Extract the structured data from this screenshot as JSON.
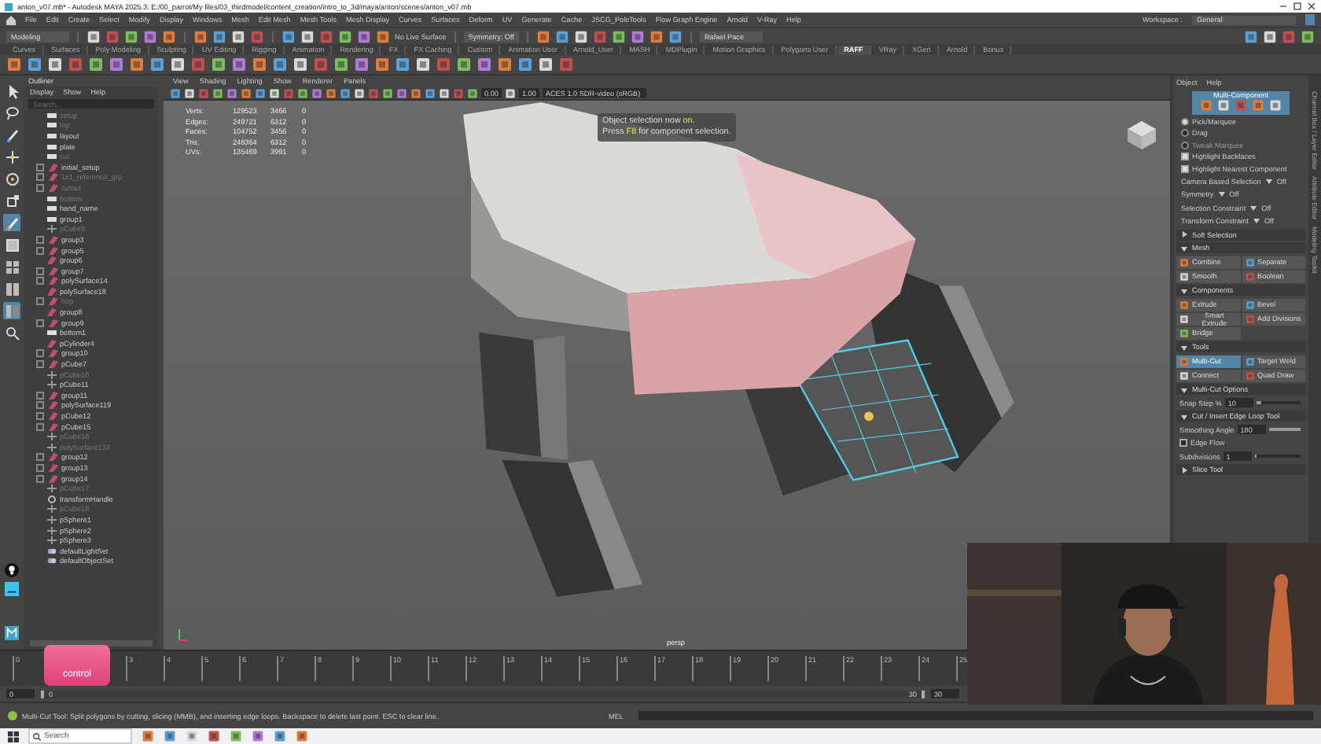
{
  "window": {
    "title": "anton_v07.mb* - Autodesk MAYA 2025.3: E:/00_parrot/My files/03_thirdmodel/content_creation/intro_to_3d/maya/anton/scenes/anton_v07.mb"
  },
  "menu": [
    "File",
    "Edit",
    "Create",
    "Select",
    "Modify",
    "Display",
    "Windows",
    "Mesh",
    "Edit Mesh",
    "Mesh Tools",
    "Mesh Display",
    "Curves",
    "Surfaces",
    "Deform",
    "UV",
    "Generate",
    "Cache",
    "JSCG_PoleTools",
    "Flow Graph Engine",
    "Arnold",
    "V-Ray",
    "Help"
  ],
  "workspace": {
    "label": "Workspace :",
    "value": "General"
  },
  "status_line": {
    "mode": "Modeling",
    "live_surface": "No Live Surface",
    "symmetry": "Symmetry: Off",
    "user": "Rafael Pace"
  },
  "shelf_tabs": [
    {
      "label": "Curves",
      "selected": false
    },
    {
      "label": "Surfaces",
      "selected": false
    },
    {
      "label": "Poly Modeling",
      "selected": false
    },
    {
      "label": "Sculpting",
      "selected": false
    },
    {
      "label": "UV Editing",
      "selected": false
    },
    {
      "label": "Rigging",
      "selected": false
    },
    {
      "label": "Animation",
      "selected": false
    },
    {
      "label": "Rendering",
      "selected": false
    },
    {
      "label": "FX",
      "selected": false
    },
    {
      "label": "FX Caching",
      "selected": false
    },
    {
      "label": "Custom",
      "selected": false
    },
    {
      "label": "Animation User",
      "selected": false
    },
    {
      "label": "Arnold_User",
      "selected": false
    },
    {
      "label": "MASH",
      "selected": false
    },
    {
      "label": "MDPlugin",
      "selected": false
    },
    {
      "label": "Motion Graphics",
      "selected": false
    },
    {
      "label": "Polygons User",
      "selected": false
    },
    {
      "label": "RAFF",
      "selected": true
    },
    {
      "label": "VRay",
      "selected": false
    },
    {
      "label": "XGen",
      "selected": false
    },
    {
      "label": "Arnold",
      "selected": false
    },
    {
      "label": "Bonus",
      "selected": false
    }
  ],
  "toolbox": [
    {
      "kind": "select",
      "selected": false
    },
    {
      "kind": "lasso",
      "selected": false
    },
    {
      "kind": "paint",
      "selected": false
    },
    {
      "kind": "move",
      "selected": false
    },
    {
      "kind": "rotate",
      "selected": false
    },
    {
      "kind": "scale",
      "selected": false
    },
    {
      "kind": "brush",
      "selected": true
    },
    {
      "kind": "single",
      "selected": false
    },
    {
      "kind": "four",
      "selected": false
    },
    {
      "kind": "two",
      "selected": false
    },
    {
      "kind": "outliner",
      "selected": true
    },
    {
      "kind": "search",
      "selected": false
    }
  ],
  "outliner": {
    "title": "Outliner",
    "menu": [
      "Display",
      "Show",
      "Help"
    ],
    "search": {
      "placeholder": "Search..."
    },
    "items": [
      {
        "label": "setup",
        "kind": "box",
        "dim": true,
        "expander": false
      },
      {
        "label": "top",
        "kind": "box",
        "dim": true,
        "expander": false
      },
      {
        "label": "layout",
        "kind": "box",
        "dim": false,
        "expander": false
      },
      {
        "label": "plate",
        "kind": "box",
        "dim": false,
        "expander": false
      },
      {
        "label": "cut",
        "kind": "box",
        "dim": true,
        "expander": false
      },
      {
        "label": "initial_setup",
        "kind": "mesh",
        "dim": false,
        "expander": true
      },
      {
        "label": "1x1_reference_grp",
        "kind": "mesh",
        "dim": true,
        "expander": true
      },
      {
        "label": "cutout",
        "kind": "mesh",
        "dim": true,
        "expander": true
      },
      {
        "label": "bottom",
        "kind": "box",
        "dim": true,
        "expander": false
      },
      {
        "label": "hand_name",
        "kind": "box",
        "dim": false,
        "expander": false
      },
      {
        "label": "group1",
        "kind": "box",
        "dim": false,
        "expander": false
      },
      {
        "label": "pCube9",
        "kind": "locator",
        "dim": true,
        "expander": false
      },
      {
        "label": "group3",
        "kind": "mesh",
        "dim": false,
        "expander": true
      },
      {
        "label": "group5",
        "kind": "mesh",
        "dim": false,
        "expander": true
      },
      {
        "label": "group6",
        "kind": "mesh",
        "dim": false,
        "expander": false
      },
      {
        "label": "group7",
        "kind": "mesh",
        "dim": false,
        "expander": true
      },
      {
        "label": "polySurface14",
        "kind": "mesh",
        "dim": false,
        "expander": true
      },
      {
        "label": "polySurface18",
        "kind": "mesh",
        "dim": false,
        "expander": false
      },
      {
        "label": "hop",
        "kind": "mesh",
        "dim": true,
        "expander": true
      },
      {
        "label": "group8",
        "kind": "mesh",
        "dim": false,
        "expander": false
      },
      {
        "label": "group9",
        "kind": "mesh",
        "dim": false,
        "expander": true
      },
      {
        "label": "bottom1",
        "kind": "box",
        "dim": false,
        "expander": false
      },
      {
        "label": "pCylinder4",
        "kind": "mesh",
        "dim": false,
        "expander": false
      },
      {
        "label": "group10",
        "kind": "mesh",
        "dim": false,
        "expander": true
      },
      {
        "label": "pCube7",
        "kind": "mesh",
        "dim": false,
        "expander": true
      },
      {
        "label": "pCube10",
        "kind": "locator",
        "dim": true,
        "expander": false
      },
      {
        "label": "pCube11",
        "kind": "locator",
        "dim": false,
        "expander": false
      },
      {
        "label": "group11",
        "kind": "mesh",
        "dim": false,
        "expander": true
      },
      {
        "label": "polySurface119",
        "kind": "mesh",
        "dim": false,
        "expander": true
      },
      {
        "label": "pCube12",
        "kind": "mesh",
        "dim": false,
        "expander": true
      },
      {
        "label": "pCube15",
        "kind": "mesh",
        "dim": false,
        "expander": true
      },
      {
        "label": "pCube16",
        "kind": "locator",
        "dim": true,
        "expander": false
      },
      {
        "label": "polySurface133",
        "kind": "locator",
        "dim": true,
        "expander": false
      },
      {
        "label": "group12",
        "kind": "mesh",
        "dim": false,
        "expander": true
      },
      {
        "label": "group13",
        "kind": "mesh",
        "dim": false,
        "expander": true
      },
      {
        "label": "group14",
        "kind": "mesh",
        "dim": false,
        "expander": true
      },
      {
        "label": "pCube17",
        "kind": "locator",
        "dim": true,
        "expander": false
      },
      {
        "label": "transformHandle",
        "kind": "gear",
        "dim": false,
        "expander": false
      },
      {
        "label": "pCube18",
        "kind": "locator",
        "dim": true,
        "expander": false
      },
      {
        "label": "pSphere1",
        "kind": "locator",
        "dim": false,
        "expander": false
      },
      {
        "label": "pSphere2",
        "kind": "locator",
        "dim": false,
        "expander": false
      },
      {
        "label": "pSphere3",
        "kind": "locator",
        "dim": false,
        "expander": false
      },
      {
        "label": "defaultLightSet",
        "kind": "set",
        "dim": false,
        "expander": false
      },
      {
        "label": "defaultObjectSet",
        "kind": "set",
        "dim": false,
        "expander": false
      }
    ]
  },
  "viewport": {
    "menu": [
      "View",
      "Shading",
      "Lighting",
      "Show",
      "Renderer",
      "Panels"
    ],
    "exposure": "0.00",
    "gamma": "1.00",
    "color_space": "ACES 1.0 SDR-video (sRGB)",
    "hud": [
      {
        "label": "Verts:",
        "values": [
          "129523",
          "3466",
          "0"
        ]
      },
      {
        "label": "Edges:",
        "values": [
          "249721",
          "6312",
          "0"
        ]
      },
      {
        "label": "Faces:",
        "values": [
          "104752",
          "3456",
          "0"
        ]
      },
      {
        "label": "Tris:",
        "values": [
          "248364",
          "6312",
          "0"
        ]
      },
      {
        "label": "UVs:",
        "values": [
          "135469",
          "3991",
          "0"
        ]
      }
    ],
    "tooltip": [
      "Object selection now **on**.",
      "Press **F8** for component selection."
    ],
    "camera": "persp"
  },
  "toolkit": {
    "menu": [
      "Object",
      "Help"
    ],
    "mode": "Multi-Component",
    "pick_modes": [
      {
        "label": "Pick/Marquee",
        "selected": true,
        "disabled": false
      },
      {
        "label": "Drag",
        "selected": false,
        "disabled": false
      },
      {
        "label": "Tweak Marquee",
        "selected": false,
        "disabled": true
      }
    ],
    "options": [
      {
        "label": "Highlight Backfaces",
        "checked": true
      },
      {
        "label": "Highlight Nearest Component",
        "checked": true
      }
    ],
    "settings": [
      {
        "label": "Camera Based Selection",
        "value": "Off"
      },
      {
        "label": "Symmetry",
        "value": "Off"
      },
      {
        "label": "Selection Constraint",
        "value": "Off"
      },
      {
        "label": "Transform Constraint",
        "value": "Off"
      }
    ],
    "sections": [
      {
        "title": "Soft Selection",
        "expanded": false
      },
      {
        "title": "Mesh",
        "expanded": true,
        "buttons": [
          {
            "label": "Combine",
            "selected": false
          },
          {
            "label": "Separate",
            "selected": false
          },
          {
            "label": "Smooth",
            "selected": false
          },
          {
            "label": "Boolean",
            "selected": false
          }
        ]
      },
      {
        "title": "Components",
        "expanded": true,
        "buttons": [
          {
            "label": "Extrude",
            "selected": false
          },
          {
            "label": "Bevel",
            "selected": false
          },
          {
            "label": "Smart Extrude",
            "selected": false
          },
          {
            "label": "Add Divisions",
            "selected": false
          },
          {
            "label": "Bridge",
            "selected": false
          }
        ]
      },
      {
        "title": "Tools",
        "expanded": true,
        "buttons": [
          {
            "label": "Multi-Cut",
            "selected": true
          },
          {
            "label": "Target Weld",
            "selected": false
          },
          {
            "label": "Connect",
            "selected": false
          },
          {
            "label": "Quad Draw",
            "selected": false
          }
        ]
      },
      {
        "title": "Multi-Cut Options",
        "expanded": true,
        "fields": [
          {
            "kind": "slider",
            "label": "Snap Step %",
            "value": "10",
            "level": 0.1
          }
        ]
      },
      {
        "title": "Cut / Insert Edge Loop Tool",
        "expanded": true,
        "fields": [
          {
            "kind": "slider",
            "label": "Smoothing Angle",
            "value": "180",
            "level": 1
          },
          {
            "kind": "check",
            "label": "Edge Flow",
            "checked": false
          },
          {
            "kind": "slider",
            "label": "Subdivisions",
            "value": "1",
            "level": 0.05
          }
        ]
      },
      {
        "title": "Slice Tool",
        "expanded": false
      }
    ]
  },
  "side_tabs": [
    "Channel Box / Layer Editor",
    "Attribute Editor",
    "Modeling Toolkit"
  ],
  "timeline": {
    "ticks": [
      "0",
      "3",
      "4",
      "5",
      "6",
      "7",
      "8",
      "9",
      "10",
      "11",
      "12",
      "13",
      "14",
      "15",
      "16",
      "17",
      "18",
      "19",
      "20",
      "21",
      "22",
      "23",
      "24",
      "25"
    ]
  },
  "range": {
    "level": 1,
    "start": "0",
    "inner_start": "0",
    "inner_end": "30",
    "end": "30"
  },
  "help_line": {
    "text": "Multi-Cut Tool: Split polygons by cutting, slicing (MMB), and inserting edge loops. Backspace to delete last point. ESC to clear line.",
    "script_label": "MEL"
  },
  "taskbar": {
    "search": "Search"
  },
  "key_overlay": {
    "key": "control"
  },
  "webcam": {
    "kind": "picture"
  }
}
